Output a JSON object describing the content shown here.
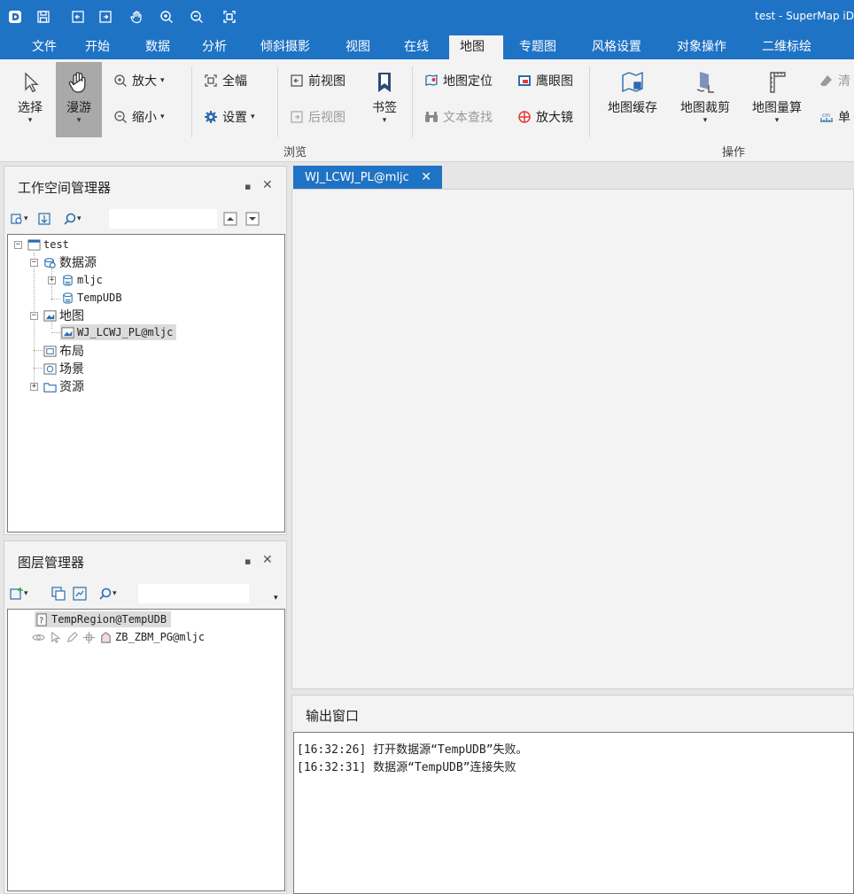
{
  "window": {
    "title": "test - SuperMap iD"
  },
  "menu_tabs": [
    "文件",
    "开始",
    "数据",
    "分析",
    "倾斜摄影",
    "视图",
    "在线",
    "地图",
    "专题图",
    "风格设置",
    "对象操作",
    "二维标绘"
  ],
  "active_menu_tab": "地图",
  "ribbon": {
    "select": "选择",
    "pan": "漫游",
    "zoom_in": "放大",
    "zoom_out": "缩小",
    "full_extent": "全幅",
    "settings": "设置",
    "prev_view": "前视图",
    "next_view": "后视图",
    "bookmark": "书签",
    "map_locate": "地图定位",
    "eagle_eye": "鹰眼图",
    "text_search": "文本查找",
    "magnifier": "放大镜",
    "map_cache": "地图缓存",
    "map_clip": "地图裁剪",
    "map_measure": "地图量算",
    "clear": "清",
    "unit": "单",
    "browse_group": "浏览",
    "operate_group": "操作"
  },
  "workspace_panel": {
    "title": "工作空间管理器",
    "tree": {
      "root": "test",
      "datasources": "数据源",
      "ds1": "mljc",
      "ds2": "TempUDB",
      "maps": "地图",
      "map1": "WJ_LCWJ_PL@mljc",
      "layouts": "布局",
      "scenes": "场景",
      "resources": "资源"
    }
  },
  "layer_panel": {
    "title": "图层管理器",
    "layers": [
      "TempRegion@TempUDB",
      "ZB_ZBM_PG@mljc"
    ]
  },
  "document_tab": {
    "label": "WJ_LCWJ_PL@mljc"
  },
  "output": {
    "title": "输出窗口",
    "lines": [
      "[16:32:26] 打开数据源“TempUDB”失败。",
      "[16:32:31] 数据源“TempUDB”连接失败"
    ]
  },
  "colors": {
    "accent": "#1f73c4",
    "panel_bg": "#f3f3f3"
  },
  "icons": [
    "app-logo-icon",
    "save-icon",
    "back-icon",
    "forward-icon",
    "hand-icon",
    "zoom-in-icon",
    "zoom-out-icon",
    "full-extent-icon"
  ]
}
